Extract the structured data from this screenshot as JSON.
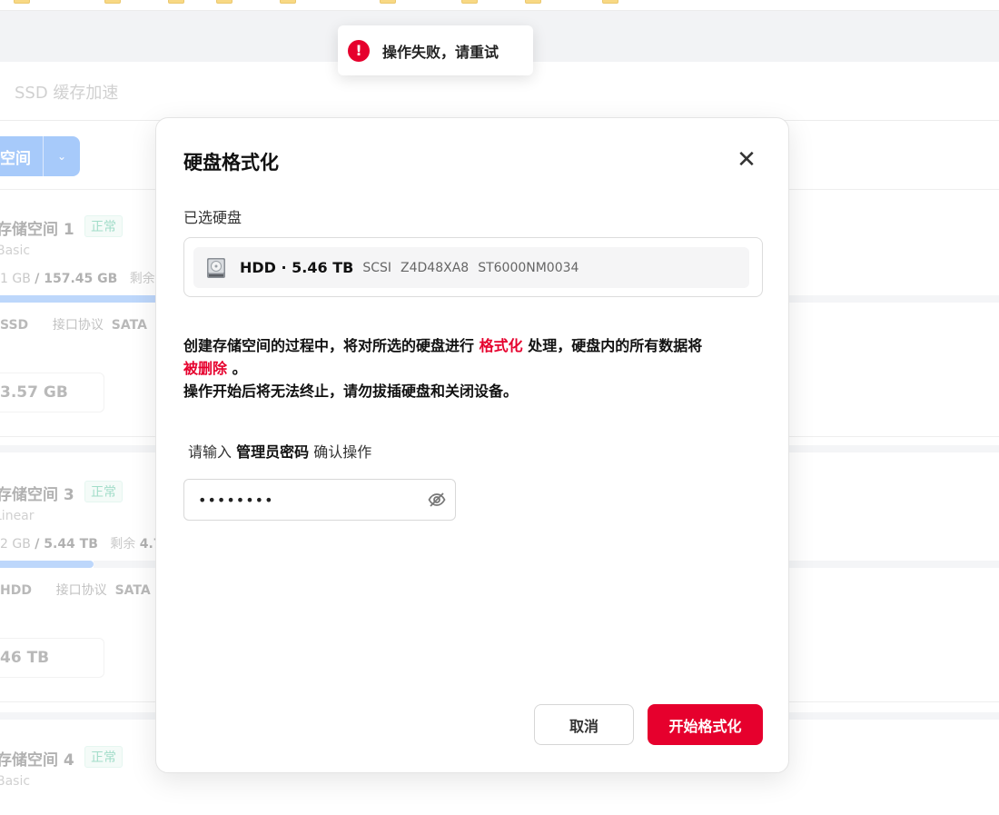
{
  "background": {
    "subtab_label": "SSD 缓存加速",
    "create_button_label": "空间",
    "pools": [
      {
        "name": "存储空间 1",
        "status": "正常",
        "type": "Basic",
        "usage_used": "1 GB",
        "usage_total": "/ 157.45 GB",
        "remaining_label": "剩余",
        "disk_kind": "SSD",
        "protocol_label": "接口协议",
        "protocol_value": "SATA",
        "capacity": "3.57 GB"
      },
      {
        "name": "存储空间 3",
        "status": "正常",
        "type": "Linear",
        "usage_used": "2 GB",
        "usage_total": "/ 5.44 TB",
        "remaining_label": "剩余",
        "remaining_value": "4.7",
        "disk_kind": "HDD",
        "protocol_label": "接口协议",
        "protocol_value": "SATA",
        "capacity": "46 TB"
      },
      {
        "name": "存储空间 4",
        "status": "正常",
        "type": "Basic"
      }
    ]
  },
  "toast": {
    "message": "操作失败，请重试",
    "icon": "error-icon",
    "color": "#e6002d"
  },
  "modal": {
    "title": "硬盘格式化",
    "close_icon": "close-icon",
    "selected_label": "已选硬盘",
    "disk": {
      "icon": "hdd-icon",
      "summary": "HDD · 5.46 TB",
      "interface": "SCSI",
      "serial": "Z4D48XA8",
      "model": "ST6000NM0034"
    },
    "warning": {
      "part1": "创建存储空间的过程中，将对所选的硬盘进行",
      "highlight1": "格式化",
      "part2": "处理，硬盘内的所有数据将",
      "highlight2": "被删除",
      "part3": "。",
      "line2": "操作开始后将无法终止，请勿拔插硬盘和关闭设备。"
    },
    "password_prompt": {
      "prefix": "请输入",
      "emphasis": "管理员密码",
      "suffix": "确认操作"
    },
    "password_value": "••••••••",
    "eye_icon": "eye-off-icon",
    "cancel_label": "取消",
    "confirm_label": "开始格式化",
    "accent_color": "#e6002d"
  }
}
